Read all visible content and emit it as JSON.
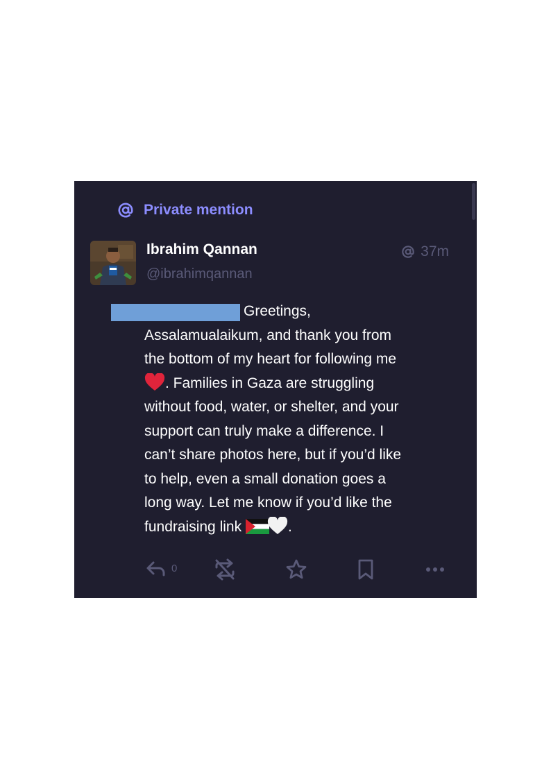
{
  "mention_label": "Private mention",
  "status": {
    "display_name": "Ibrahim Qannan",
    "handle": "@ibrahimqannan",
    "time": "37m",
    "visibility_icon": "at-icon",
    "content": {
      "line1": "Greetings,",
      "lines": [
        "Assalamualaikum, and thank you from",
        "the bottom of my heart for following me"
      ],
      "after_heart": ". Families in Gaza are struggling",
      "lines2": [
        "without food, water, or shelter, and your",
        "support can truly make a difference. I",
        "can’t share photos here, but if you’d like",
        "to help, even a small donation goes a",
        "long way. Let me know if you’d like the"
      ],
      "last_line_prefix": "fundraising link",
      "last_line_suffix": "."
    }
  },
  "actions": {
    "reply_icon": "reply-icon",
    "reply_count": "0",
    "boost_icon": "boost-disabled-icon",
    "favourite_icon": "star-icon",
    "bookmark_icon": "bookmark-icon",
    "more_icon": "ellipsis-icon"
  },
  "colors": {
    "background": "#1f1e2f",
    "accent": "#8c8dff",
    "muted": "#5a5a78",
    "redaction": "#6f9fd8"
  }
}
